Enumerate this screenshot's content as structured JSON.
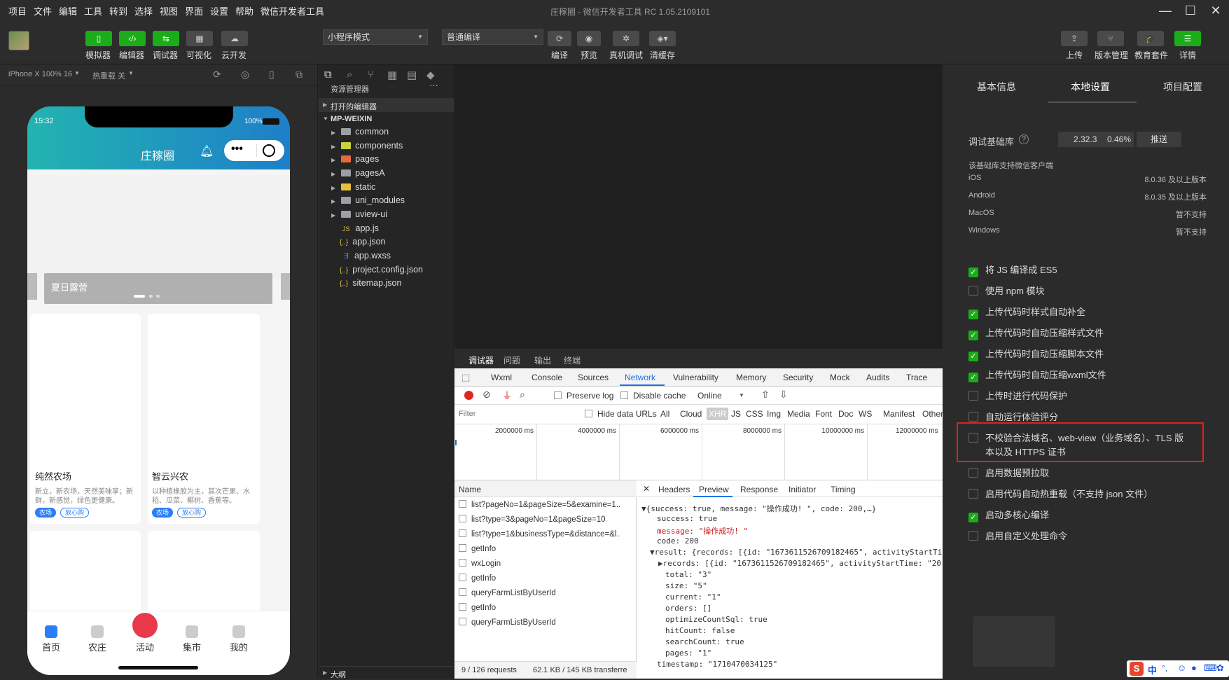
{
  "menubar": {
    "items": [
      "项目",
      "文件",
      "编辑",
      "工具",
      "转到",
      "选择",
      "视图",
      "界面",
      "设置",
      "帮助",
      "微信开发者工具"
    ],
    "title": "庄稼圈 - 微信开发者工具 RC 1.05.2109101"
  },
  "toolbar": {
    "left_buttons": [
      "模拟器",
      "编辑器",
      "调试器",
      "可视化",
      "云开发"
    ],
    "mode_select": "小程序模式",
    "compile_select": "普通编译",
    "center_buttons": [
      "编译",
      "预览",
      "真机调试",
      "清缓存"
    ],
    "right_buttons": [
      "上传",
      "版本管理",
      "教育套件",
      "详情"
    ]
  },
  "simbar": {
    "device": "iPhone X 100% 16",
    "hotreload": "热重载 关"
  },
  "phone": {
    "time": "15:32",
    "battery": "100%",
    "title": "庄稼圈",
    "banner_text": "夏日露营",
    "cards": [
      {
        "title": "纯然农场",
        "desc1": "新立，新农场，天然美味享；新",
        "desc2": "鲜，新感觉，绿色更健康。",
        "tags": [
          "农场",
          "放心购"
        ]
      },
      {
        "title": "智云兴农",
        "desc1": "以种植橡胶为主，其次芒果、水",
        "desc2": "稻、瓜菜、椰树、香蕉等。",
        "tags": [
          "农场",
          "放心购"
        ]
      }
    ],
    "tabs": [
      "首页",
      "农庄",
      "活动",
      "集市",
      "我的"
    ]
  },
  "explorer": {
    "title": "资源管理器",
    "open_editors": "打开的编辑器",
    "root": "MP-WEIXIN",
    "folders": [
      "common",
      "components",
      "pages",
      "pagesA",
      "static",
      "uni_modules",
      "uview-ui"
    ],
    "files": [
      "app.js",
      "app.json",
      "app.wxss",
      "project.config.json",
      "sitemap.json"
    ],
    "outline": "大纲"
  },
  "devtools": {
    "top_tabs": [
      "调试器",
      "问题",
      "输出",
      "终端"
    ],
    "tabs": [
      "Wxml",
      "Console",
      "Sources",
      "Network",
      "Vulnerability",
      "Memory",
      "Security",
      "Mock",
      "Audits",
      "Trace"
    ],
    "preserve_log": "Preserve log",
    "disable_cache": "Disable cache",
    "online": "Online",
    "filter_placeholder": "Filter",
    "hide_data_urls": "Hide data URLs",
    "types": [
      "All",
      "Cloud",
      "XHR",
      "JS",
      "CSS",
      "Img",
      "Media",
      "Font",
      "Doc",
      "WS",
      "Manifest",
      "Other"
    ],
    "timeline": [
      "2000000 ms",
      "4000000 ms",
      "6000000 ms",
      "8000000 ms",
      "10000000 ms",
      "12000000 ms"
    ],
    "name_header": "Name",
    "requests": [
      "list?pageNo=1&pageSize=5&examine=1...",
      "list?type=3&pageNo=1&pageSize=10",
      "list?type=1&businessType=&distance=&l...",
      "getInfo",
      "wxLogin",
      "getInfo",
      "queryFarmListByUserId",
      "getInfo",
      "queryFarmListByUserId"
    ],
    "detail_tabs": [
      "Headers",
      "Preview",
      "Response",
      "Initiator",
      "Timing"
    ],
    "json_lines": [
      "▼{success: true, message: \"操作成功! \", code: 200,…}",
      "success: true",
      "message: \"操作成功! \"",
      "code: 200",
      "▼result: {records: [{id: \"1673611526709182465\", activityStartTi",
      "▶records: [{id: \"1673611526709182465\", activityStartTime: \"20",
      "total: \"3\"",
      "size: \"5\"",
      "current: \"1\"",
      "orders: []",
      "optimizeCountSql: true",
      "hitCount: false",
      "searchCount: true",
      "pages: \"1\"",
      "timestamp: \"1710470034125\""
    ],
    "status_requests": "9 / 126 requests",
    "status_size": "62.1 KB / 145 KB transferre"
  },
  "settings": {
    "tabs": [
      "基本信息",
      "本地设置",
      "项目配置"
    ],
    "lib_label": "调试基础库",
    "lib_version": "2.32.3",
    "lib_percent": "0.46%",
    "push": "推送",
    "support_title": "该基础库支持微信客户端",
    "support": [
      {
        "os": "iOS",
        "ver": "8.0.36 及以上版本"
      },
      {
        "os": "Android",
        "ver": "8.0.35 及以上版本"
      },
      {
        "os": "MacOS",
        "ver": "暂不支持"
      },
      {
        "os": "Windows",
        "ver": "暂不支持"
      }
    ],
    "options": [
      {
        "label": "将 JS 编译成 ES5",
        "checked": true
      },
      {
        "label": "使用 npm 模块",
        "checked": false
      },
      {
        "label": "上传代码时样式自动补全",
        "checked": true
      },
      {
        "label": "上传代码时自动压缩样式文件",
        "checked": true
      },
      {
        "label": "上传代码时自动压缩脚本文件",
        "checked": true
      },
      {
        "label": "上传代码时自动压缩wxml文件",
        "checked": true
      },
      {
        "label": "上传时进行代码保护",
        "checked": false
      },
      {
        "label": "自动运行体验评分",
        "checked": false
      },
      {
        "label": "不校验合法域名、web-view（业务域名）、TLS 版",
        "label2": "本以及 HTTPS 证书",
        "checked": false
      },
      {
        "label": "启用数据预拉取",
        "checked": false
      },
      {
        "label": "启用代码自动热重载（不支持 json 文件）",
        "checked": false
      },
      {
        "label": "启动多核心编译",
        "checked": true
      },
      {
        "label": "启用自定义处理命令",
        "checked": false
      }
    ],
    "highlight_color": "#e02020"
  },
  "ime": {
    "label": "中"
  }
}
